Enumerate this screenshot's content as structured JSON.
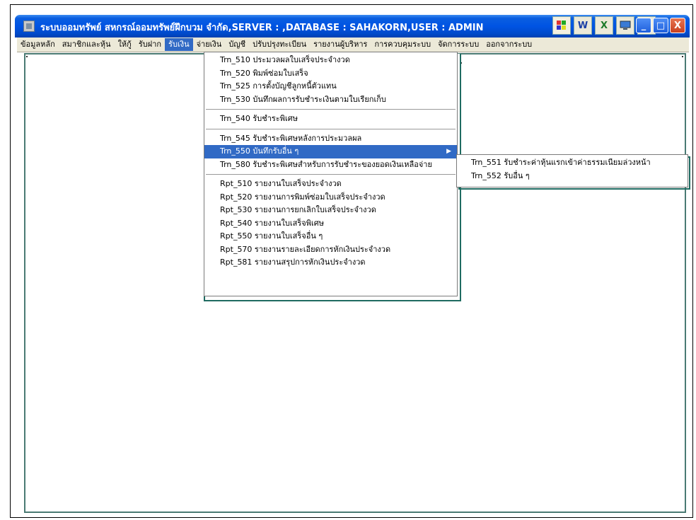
{
  "window": {
    "title": "ระบบออมทรัพย์ สหกรณ์ออมทรัพย์ฝึกบวม จำกัด,SERVER : ,DATABASE : SAHAKORN,USER : ADMIN",
    "tray_icons": [
      "grid-icon",
      "word-icon",
      "excel-icon",
      "monitor-icon",
      "key-icon"
    ],
    "controls": [
      "_",
      "□",
      "X"
    ]
  },
  "menubar": {
    "items": [
      "ข้อมูลหลัก",
      "สมาชิกและหุ้น",
      "ให้กู้",
      "รับฝาก",
      "รับเงิน",
      "จ่ายเงิน",
      "บัญชี",
      "ปรับปรุงทะเบียน",
      "รายงานผู้บริหาร",
      "การควบคุมระบบ",
      "จัดการระบบ",
      "ออกจากระบบ"
    ],
    "active_index": 4
  },
  "dropdown": {
    "groups": [
      [
        "Trn_510 ประมวลผลใบเสร็จประจำงวด",
        "Trn_520 พิมพ์ซ่อมใบเสร็จ",
        "Trn_525 การตั้งบัญชีลูกหนี้ตัวแทน",
        "Trn_530 บันทึกผลการรับชำระเงินตามใบเรียกเก็บ"
      ],
      [
        "Trn_540 รับชำระพิเศษ"
      ],
      [
        "Trn_545 รับชำระพิเศษหลังการประมวลผล",
        "Trn_550 บันทึกรับอื่น ๆ",
        "Trn_580 รับชำระพิเศษสำหรับการรับชำระของยอดเงินเหลือจ่าย"
      ],
      [
        "Rpt_510 รายงานใบเสร็จประจำงวด",
        "Rpt_520 รายงานการพิมพ์ซ่อมใบเสร็จประจำงวด",
        "Rpt_530 รายงานการยกเลิกใบเสร็จประจำงวด",
        "Rpt_540 รายงานใบเสร็จพิเศษ",
        "Rpt_550 รายงานใบเสร็จอื่น ๆ",
        "Rpt_570 รายงานรายละเอียดการหักเงินประจำงวด",
        "Rpt_581 รายงานสรุปการหักเงินประจำงวด"
      ]
    ],
    "highlighted": "Trn_550 บันทึกรับอื่น ๆ",
    "submenu_arrow": "▶"
  },
  "submenu": {
    "items": [
      "Trn_551 รับชำระค่าหุ้นแรกเข้าค่าธรรมเนียมล่วงหน้า",
      "Trn_552 รับอื่น ๆ"
    ]
  }
}
